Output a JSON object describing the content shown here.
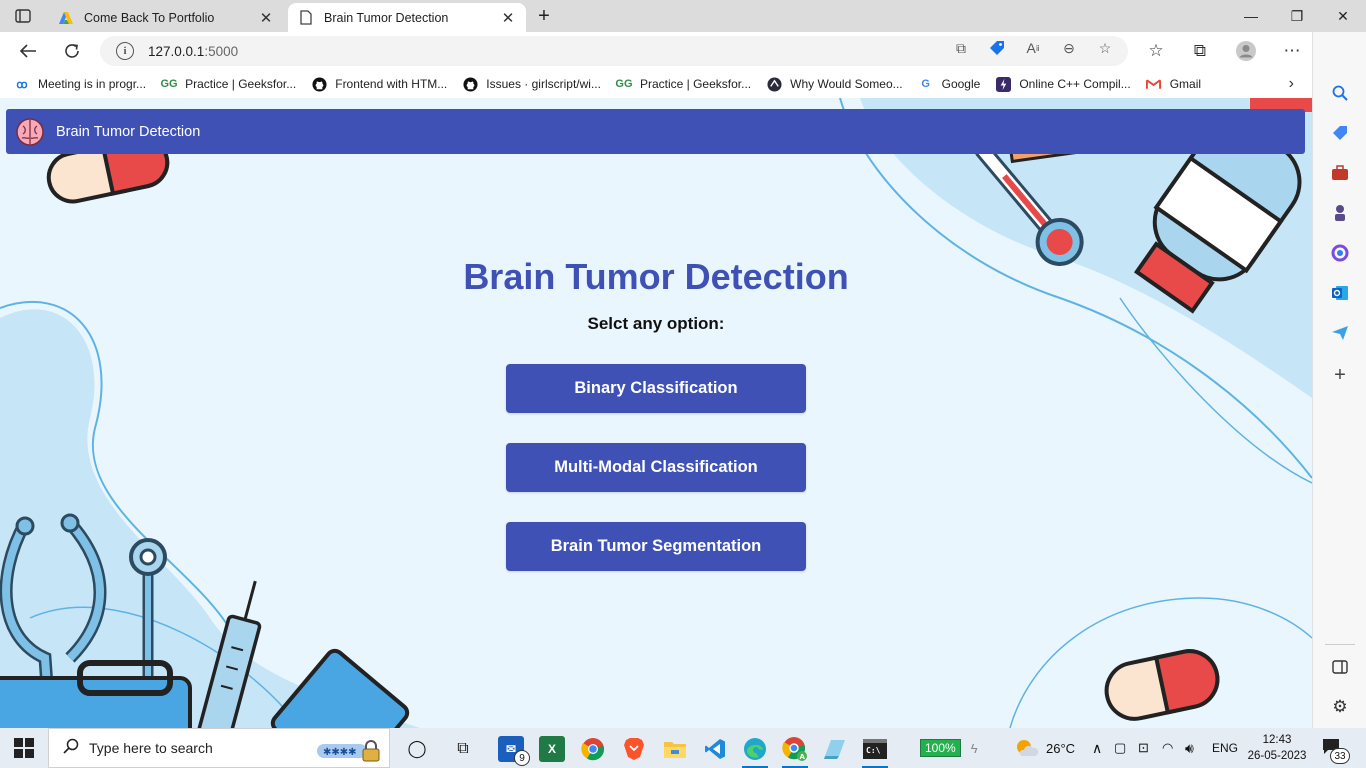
{
  "browser": {
    "tabs": [
      {
        "title": "Come Back To Portfolio",
        "active": false
      },
      {
        "title": "Brain Tumor Detection",
        "active": true
      }
    ],
    "address": {
      "host": "127.0.0.1",
      "port": ":5000"
    },
    "bookmarks": [
      "Meeting is in progr...",
      "Practice | Geeksfor...",
      "Frontend with HTM...",
      "Issues · girlscript/wi...",
      "Practice | Geeksfor...",
      "Why Would Someo...",
      "Google",
      "Online C++ Compil...",
      "Gmail"
    ]
  },
  "page": {
    "nav_title": "Brain Tumor Detection",
    "heading": "Brain Tumor Detection",
    "subheading": "Selct any option:",
    "options": [
      "Binary Classification",
      "Multi-Modal Classification",
      "Brain Tumor Segmentation"
    ],
    "colors": {
      "primary": "#3f51b5",
      "background": "#eaf6fd"
    }
  },
  "taskbar": {
    "search_placeholder": "Type here to search",
    "mail_badge": "9",
    "battery": "100%",
    "weather": "26°C",
    "language": "ENG",
    "time": "12:43",
    "date": "26-05-2023",
    "notifications": "33"
  }
}
